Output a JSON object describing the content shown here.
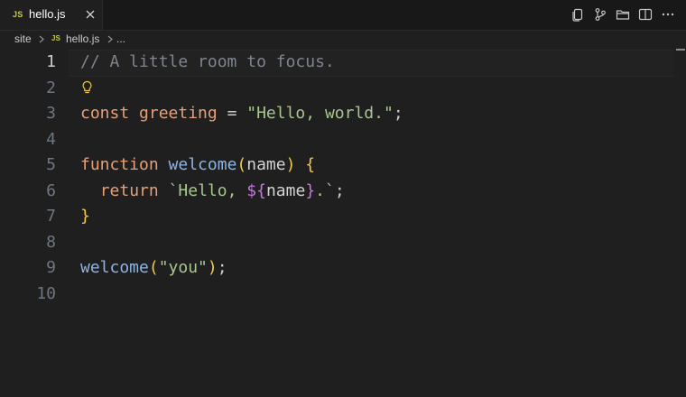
{
  "tab": {
    "icon_label": "JS",
    "label": "hello.js"
  },
  "icons": {
    "close": "close-icon",
    "actions": [
      "copy-icon",
      "source-control-icon",
      "folder-icon",
      "split-editor-icon",
      "more-icon"
    ],
    "lightbulb": "lightbulb-icon"
  },
  "breadcrumb": {
    "folder": "site",
    "file_icon_label": "JS",
    "file": "hello.js",
    "more": "..."
  },
  "editor": {
    "active_line": 1,
    "line_numbers": [
      "1",
      "2",
      "3",
      "4",
      "5",
      "6",
      "7",
      "8",
      "9",
      "10"
    ],
    "lines": [
      [
        {
          "t": "comment",
          "v": "// A little room to focus."
        }
      ],
      [],
      [
        {
          "t": "keyword",
          "v": "const"
        },
        {
          "t": "op",
          "v": " "
        },
        {
          "t": "var",
          "v": "greeting"
        },
        {
          "t": "op",
          "v": " = "
        },
        {
          "t": "string",
          "v": "\"Hello, world.\""
        },
        {
          "t": "punct",
          "v": ";"
        }
      ],
      [],
      [
        {
          "t": "keyword",
          "v": "function"
        },
        {
          "t": "op",
          "v": " "
        },
        {
          "t": "func",
          "v": "welcome"
        },
        {
          "t": "brace",
          "v": "("
        },
        {
          "t": "param",
          "v": "name"
        },
        {
          "t": "brace",
          "v": ")"
        },
        {
          "t": "op",
          "v": " "
        },
        {
          "t": "brace",
          "v": "{"
        }
      ],
      [
        {
          "t": "op",
          "v": "  "
        },
        {
          "t": "keyword",
          "v": "return"
        },
        {
          "t": "op",
          "v": " "
        },
        {
          "t": "string",
          "v": "`Hello, "
        },
        {
          "t": "interp",
          "v": "${"
        },
        {
          "t": "param",
          "v": "name"
        },
        {
          "t": "interp",
          "v": "}"
        },
        {
          "t": "string",
          "v": ".`"
        },
        {
          "t": "punct",
          "v": ";"
        }
      ],
      [
        {
          "t": "brace",
          "v": "}"
        }
      ],
      [],
      [
        {
          "t": "func",
          "v": "welcome"
        },
        {
          "t": "brace",
          "v": "("
        },
        {
          "t": "string",
          "v": "\"you\""
        },
        {
          "t": "brace",
          "v": ")"
        },
        {
          "t": "punct",
          "v": ";"
        }
      ],
      []
    ]
  },
  "colors": {
    "background": "#1f1f1f",
    "tabbar": "#181818",
    "comment": "#7f848e",
    "keyword": "#e5a07a",
    "string": "#a8c68f",
    "function": "#8db4e2",
    "brace": "#f2c94c",
    "interpolation": "#c678dd",
    "js_badge": "#cbcb41"
  }
}
